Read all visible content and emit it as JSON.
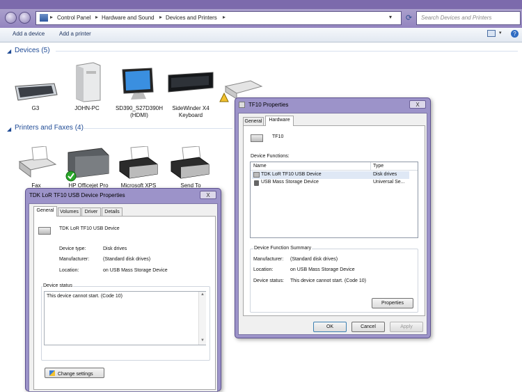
{
  "address_bar": {
    "crumbs": [
      "Control Panel",
      "Hardware and Sound",
      "Devices and Printers"
    ],
    "search_placeholder": "Search Devices and Printers"
  },
  "command_bar": {
    "add_device": "Add a device",
    "add_printer": "Add a printer"
  },
  "devices": {
    "title": "Devices (5)",
    "items": [
      {
        "label": "G3",
        "icon": "keyboard-icon"
      },
      {
        "label": "JOHN-PC",
        "icon": "computer-tower-icon"
      },
      {
        "label": "SD390_S27D390H (HDMI)",
        "icon": "monitor-icon"
      },
      {
        "label": "SideWinder X4 Keyboard",
        "icon": "keyboard-icon"
      },
      {
        "label": "",
        "icon": "usb-drive-warning-icon"
      }
    ]
  },
  "printers": {
    "title": "Printers and Faxes (4)",
    "items": [
      {
        "label": "Fax",
        "icon": "fax-icon"
      },
      {
        "label": "HP Officejet Pro",
        "icon": "printer-default-icon"
      },
      {
        "label": "Microsoft XPS",
        "icon": "printer-icon"
      },
      {
        "label": "Send To",
        "icon": "printer-icon"
      }
    ]
  },
  "tf10_dialog": {
    "title": "TF10 Properties",
    "close": "X",
    "tabs": [
      "General",
      "Hardware"
    ],
    "device_name": "TF10",
    "functions_label": "Device Functions:",
    "columns": [
      "Name",
      "Type"
    ],
    "rows": [
      {
        "name": "TDK LoR TF10 USB Device",
        "type": "Disk drives"
      },
      {
        "name": "USB Mass Storage Device",
        "type": "Universal Se..."
      }
    ],
    "summary_label": "Device Function Summary",
    "summary": [
      {
        "key": "Manufacturer:",
        "value": "(Standard disk drives)"
      },
      {
        "key": "Location:",
        "value": "on USB Mass Storage Device"
      },
      {
        "key": "Device status:",
        "value": "This device cannot start. (Code 10)"
      }
    ],
    "properties_button": "Properties",
    "ok": "OK",
    "cancel": "Cancel",
    "apply": "Apply"
  },
  "usb_dialog": {
    "title": "TDK LoR TF10 USB Device Properties",
    "close": "X",
    "tabs": [
      "General",
      "Volumes",
      "Driver",
      "Details"
    ],
    "device_name": "TDK LoR TF10 USB Device",
    "info": [
      {
        "key": "Device type:",
        "value": "Disk drives"
      },
      {
        "key": "Manufacturer:",
        "value": "(Standard disk drives)"
      },
      {
        "key": "Location:",
        "value": "on USB Mass Storage Device"
      }
    ],
    "status_label": "Device status",
    "status_text": "This device cannot start. (Code 10)",
    "change_settings": "Change settings"
  }
}
